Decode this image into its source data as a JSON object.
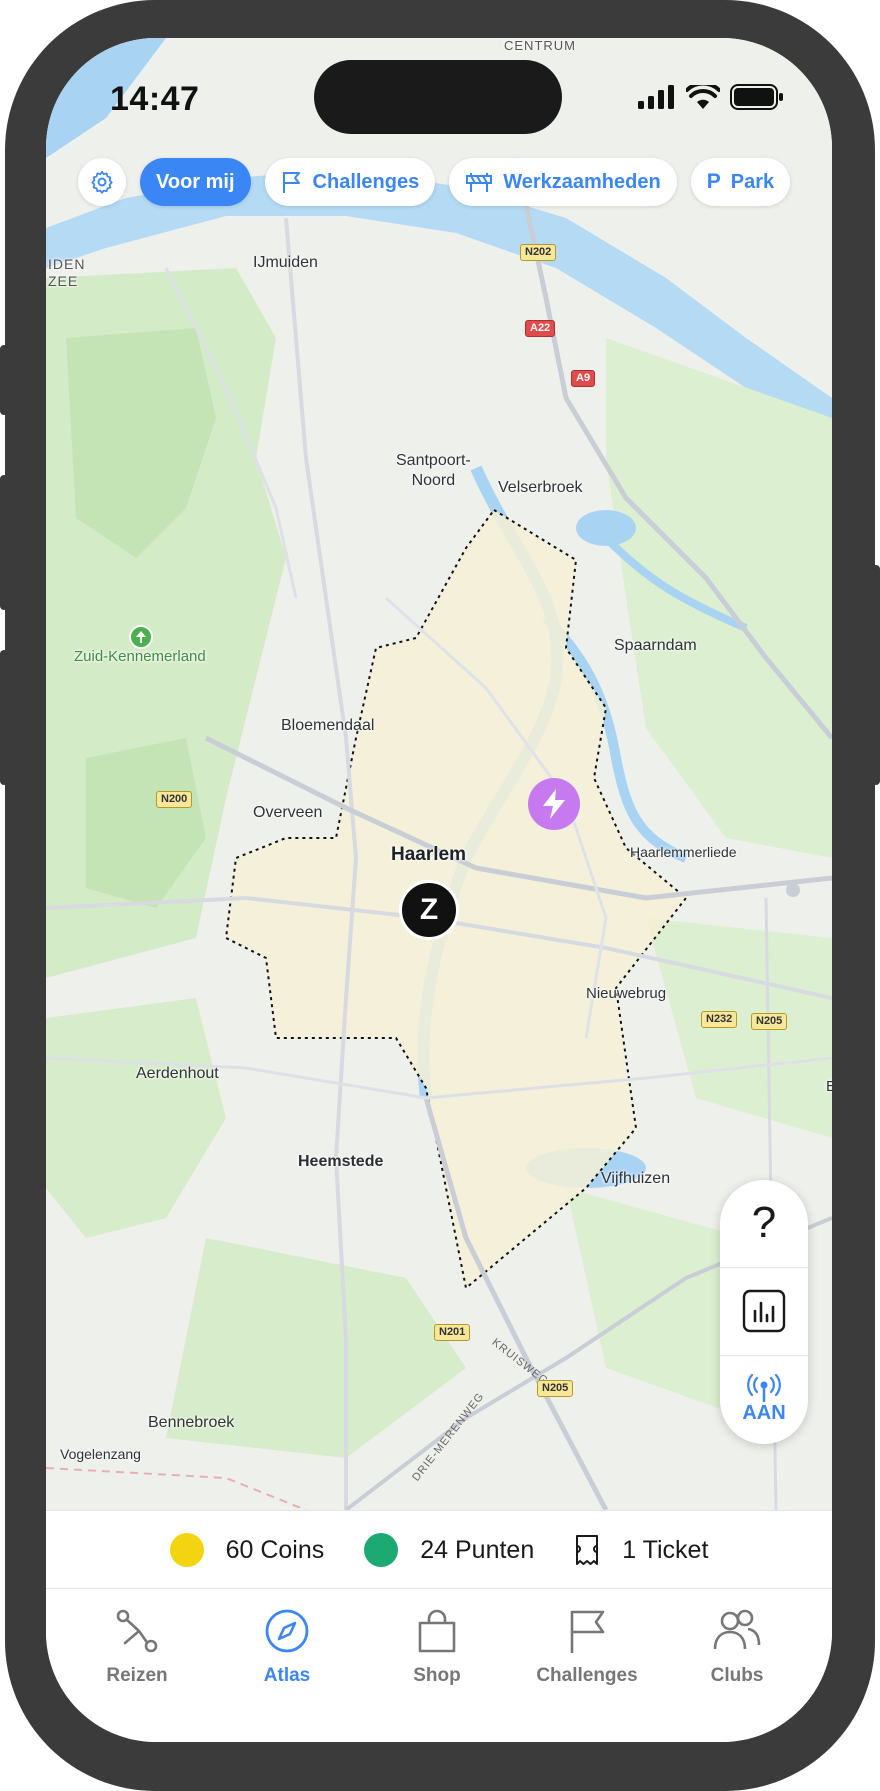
{
  "status_bar": {
    "time": "14:47"
  },
  "filters": {
    "items": [
      {
        "label": "Voor mij",
        "icon": "gear-icon"
      },
      {
        "label": "Challenges",
        "icon": "flag-icon"
      },
      {
        "label": "Werkzaamheden",
        "icon": "roadwork-icon"
      },
      {
        "label": "Park",
        "icon": "parking-icon",
        "prefix": "P"
      }
    ]
  },
  "map": {
    "labels": {
      "centrum": "CENTRUM",
      "ijmuiden": "IJmuiden",
      "iden_zee": "IDEN\nZEE",
      "santpoort": "Santpoort-\nNoord",
      "velserbroek": "Velserbroek",
      "zuid_kennemerland": "Zuid-Kennemerland",
      "spaarndam": "Spaarndam",
      "bloemendaal": "Bloemendaal",
      "overveen": "Overveen",
      "haarlem": "Haarlem",
      "haarlemmerliede": "Haarlemmerliede",
      "nieuwebrug": "Nieuwebrug",
      "aerdenhout": "Aerdenhout",
      "heemstede": "Heemstede",
      "vijfhuizen": "Vijfhuizen",
      "bennebroek": "Bennebroek",
      "vogelenzang": "Vogelenzang",
      "kruisweg": "KRUISWEG",
      "drie_merenweg": "DRIE-MERENWEG",
      "edge_b": "E"
    },
    "shields": {
      "n202": "N202",
      "a22": "A22",
      "a9": "A9",
      "n200": "N200",
      "n232": "N232",
      "n205a": "N205",
      "n201": "N201",
      "n205b": "N205"
    },
    "pins": {
      "zone_letter": "Z"
    }
  },
  "map_controls": {
    "help": "?",
    "live_label": "AAN"
  },
  "balance": {
    "coins": "60 Coins",
    "points": "24 Punten",
    "tickets": "1 Ticket",
    "coin_color": "#f2d510",
    "points_color": "#1daa72"
  },
  "tabbar": {
    "items": [
      {
        "label": "Reizen"
      },
      {
        "label": "Atlas",
        "active": true
      },
      {
        "label": "Shop"
      },
      {
        "label": "Challenges"
      },
      {
        "label": "Clubs"
      }
    ]
  },
  "colors": {
    "accent": "#3a86f5",
    "bolt_pin": "#c77af0"
  }
}
